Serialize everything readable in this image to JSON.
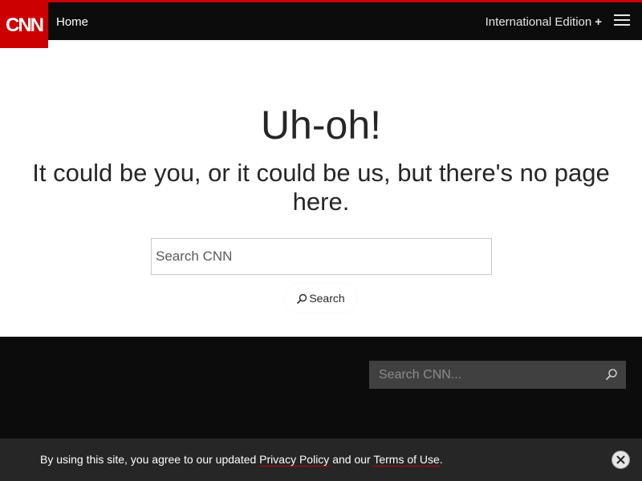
{
  "header": {
    "logo_text": "CNN",
    "home_label": "Home",
    "edition_label": "International Edition",
    "edition_toggle_symbol": "+",
    "menu_icon": "hamburger-menu-icon",
    "colors": {
      "brand_red": "#cc0000",
      "header_bg": "#0c0c0c"
    }
  },
  "error": {
    "title": "Uh-oh!",
    "message": "It could be you, or it could be us, but there's no page here.",
    "search_placeholder": "Search CNN",
    "search_button_label": "Search",
    "search_button_icon": "magnifier-icon"
  },
  "footer": {
    "search_placeholder": "Search CNN...",
    "search_icon": "magnifier-icon",
    "colors": {
      "footer_bg": "#0c0c0c",
      "search_bg": "#404040"
    }
  },
  "consent": {
    "text_before": "By using this site, you agree to our updated ",
    "privacy_link": "Privacy Policy",
    "text_middle": " and our ",
    "terms_link": "Terms of Use",
    "text_after": ".",
    "close_icon": "close-icon",
    "colors": {
      "bar_bg": "#262626",
      "link_underline": "#cc0000"
    }
  }
}
